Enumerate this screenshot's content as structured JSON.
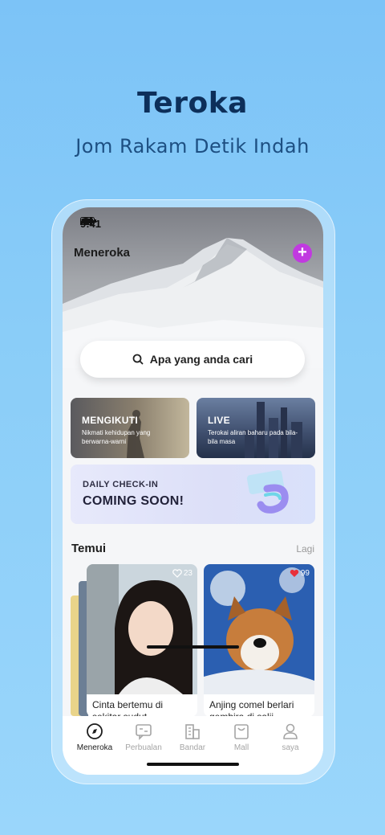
{
  "promo": {
    "title": "Teroka",
    "subtitle": "Jom Rakam Detik Indah"
  },
  "status": {
    "time": "9:41"
  },
  "hero": {
    "title": "Meneroka",
    "add_label": "+"
  },
  "search": {
    "placeholder": "Apa yang anda cari"
  },
  "cards": [
    {
      "title": "MENGIKUTI",
      "desc": "Nikmati kehidupan yang berwarna-warni"
    },
    {
      "title": "LIVE",
      "desc": "Terokai aliran baharu pada bila-bila masa"
    }
  ],
  "checkin": {
    "top": "DAILY CHECK-IN",
    "main": "COMING SOON!"
  },
  "discover": {
    "title": "Temui",
    "more": "Lagi"
  },
  "feed": [
    {
      "caption": "Cinta bertemu di sekitar sudut",
      "likes": "23",
      "liked": false
    },
    {
      "caption": "Anjing comel berlari gembira di salji",
      "likes": "99",
      "liked": true
    }
  ],
  "tabs": [
    {
      "label": "Meneroka",
      "icon": "compass-icon",
      "active": true
    },
    {
      "label": "Perbualan",
      "icon": "chat-icon",
      "active": false
    },
    {
      "label": "Bandar",
      "icon": "city-icon",
      "active": false
    },
    {
      "label": "Mall",
      "icon": "bag-icon",
      "active": false
    },
    {
      "label": "saya",
      "icon": "person-icon",
      "active": false
    }
  ],
  "colors": {
    "accent": "#c13ae0",
    "like_red": "#e8303a",
    "title_navy": "#0d2f5a"
  }
}
